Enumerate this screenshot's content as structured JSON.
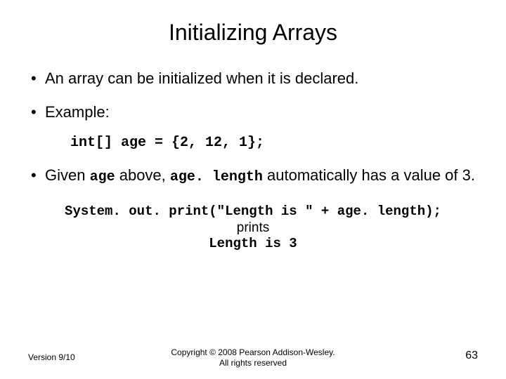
{
  "title": "Initializing Arrays",
  "bullets": {
    "b1": "An array can be initialized when it is declared.",
    "b2": "Example:",
    "code1": "int[] age = {2, 12, 1};",
    "b3_pre": "Given ",
    "b3_code1": "age",
    "b3_mid": " above, ",
    "b3_code2": "age. length",
    "b3_post": " automatically has a value of 3."
  },
  "output": {
    "stmt": "System. out. print(\"Length is \" + age. length);",
    "prints": "prints",
    "result": "Length is 3"
  },
  "footer": {
    "left": "Version 9/10",
    "center1": "Copyright © 2008 Pearson Addison-Wesley.",
    "center2": "All rights reserved",
    "right": "63"
  }
}
